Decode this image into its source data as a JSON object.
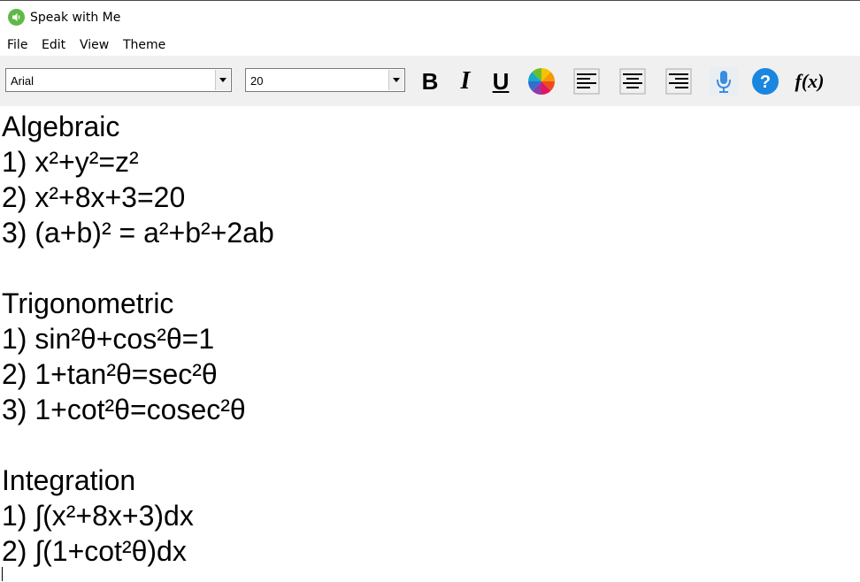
{
  "window": {
    "title": "Speak with Me",
    "accent_color": "#5fb946"
  },
  "menu": {
    "items": [
      "File",
      "Edit",
      "View",
      "Theme"
    ]
  },
  "toolbar": {
    "font_name": "Arial",
    "font_size": "20",
    "bold_label": "B",
    "italic_label": "I",
    "underline_label": "U",
    "icons": [
      "color-wheel-icon",
      "align-left-icon",
      "align-center-icon",
      "align-right-icon",
      "microphone-icon",
      "help-icon",
      "function-icon"
    ],
    "help_label": "?",
    "function_label": "f(x)"
  },
  "document": {
    "lines": [
      "Algebraic",
      "1) x²+y²=z²",
      "2) x²+8x+3=20",
      "3) (a+b)² = a²+b²+2ab",
      "",
      "Trigonometric",
      "1) sin²θ+cos²θ=1",
      "2) 1+tan²θ=sec²θ",
      "3) 1+cot²θ=cosec²θ",
      "",
      "Integration",
      "1) ∫(x²+8x+3)dx",
      "2) ∫(1+cot²θ)dx"
    ]
  }
}
